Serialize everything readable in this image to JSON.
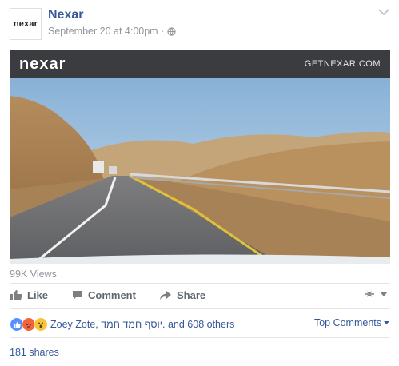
{
  "post": {
    "page_name": "Nexar",
    "timestamp": "September 20 at 4:00pm ·",
    "avatar_logo": "nexar",
    "privacy_icon": "globe-icon"
  },
  "video": {
    "overlay_logo": "nexar",
    "overlay_url": "GETNEXAR.COM",
    "views": "99K Views"
  },
  "actions": {
    "like_label": "Like",
    "comment_label": "Comment",
    "share_label": "Share"
  },
  "reactions": {
    "summary": "Zoey Zote, יוסף חמד חמד. and 608 others",
    "icons": [
      "like-reaction-icon",
      "angry-reaction-icon",
      "wow-reaction-icon"
    ],
    "colors": {
      "like": "#5890ff",
      "angry": "#f0653d",
      "wow": "#f7c43b"
    }
  },
  "comments": {
    "filter_label": "Top Comments"
  },
  "shares": {
    "label": "181 shares"
  },
  "theme": {
    "link_color": "#365899",
    "muted_color": "#90949c",
    "video_bar": "#3a3c40"
  }
}
